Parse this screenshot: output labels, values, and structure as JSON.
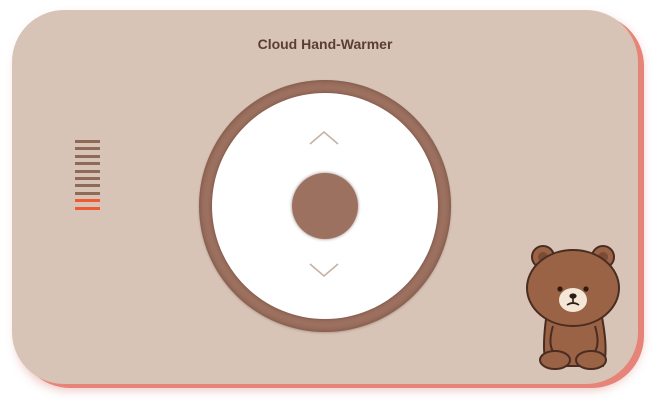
{
  "device": {
    "title": "Cloud Hand-Warmer"
  },
  "heat_level": {
    "total_segments": 10,
    "active_segments": 2,
    "active_color": "#ef5a35",
    "inactive_color": "#8f6a58"
  },
  "controls": {
    "up_icon": "chevron-up-icon",
    "down_icon": "chevron-down-icon",
    "center_icon": "circle-button"
  },
  "colors": {
    "body": "#d8c4b6",
    "accent_shadow": "#e7847a",
    "dial_ring": "#9d7160",
    "dial_face": "#ffffff"
  },
  "mascot": {
    "icon": "brown-bear-icon"
  }
}
